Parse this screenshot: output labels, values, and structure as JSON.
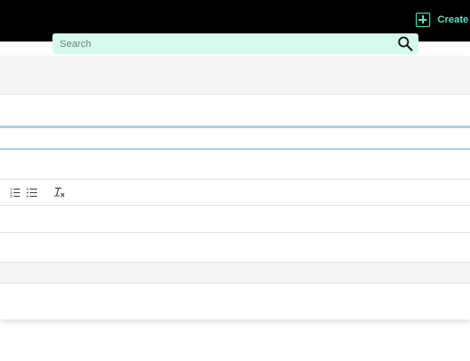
{
  "header": {
    "create_label": "Create",
    "create_icon": "plus-square-icon",
    "accent_color": "#5fe0c2"
  },
  "search": {
    "placeholder": "Search",
    "icon": "search-icon"
  },
  "editor_toolbar": {
    "tools": [
      "ordered-list-icon",
      "bullet-list-icon",
      "clear-formatting-icon"
    ]
  }
}
